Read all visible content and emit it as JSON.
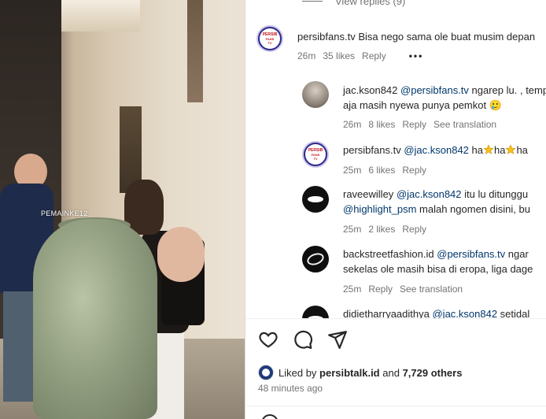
{
  "photo": {
    "watermark": "PEMAINKE12"
  },
  "view_replies": "View replies (9)",
  "main_comment": {
    "username": "persibfans.tv",
    "text": "Bisa nego sama ole buat musim depan",
    "time": "26m",
    "likes": "35 likes",
    "reply": "Reply",
    "more": "•••",
    "avatar_label_1": "PERSIB",
    "avatar_label_2": "FANS",
    "avatar_label_3": "TV"
  },
  "replies": [
    {
      "username": "jac.kson842",
      "mention": "@persibfans.tv",
      "text_line1": " ngarep lu. , tempat",
      "text_line2": "aja masih nyewa punya pemkot 🥲",
      "time": "26m",
      "likes": "8 likes",
      "reply": "Reply",
      "translate": "See translation"
    },
    {
      "username": "persibfans.tv",
      "mention": "@jac.kson842",
      "text_parts": [
        " ha",
        "ha",
        "ha"
      ],
      "time": "25m",
      "likes": "6 likes",
      "reply": "Reply"
    },
    {
      "username": "raveewilley",
      "mention": "@jac.kson842",
      "text_line1": " itu lu ditunggu",
      "mention2": "@highlight_psm",
      "text_line2": " malah ngomen disini, bu",
      "time": "25m",
      "likes": "2 likes",
      "reply": "Reply"
    },
    {
      "username": "backstreetfashion.id",
      "mention": "@persibfans.tv",
      "text_line1": " ngar",
      "text_line2": "sekelas ole masih bisa di eropa, liga dage",
      "time": "25m",
      "reply": "Reply",
      "translate": "See translation"
    },
    {
      "username": "didietharryaadithya",
      "mention": "@jac.kson842",
      "text_line1": " setidal"
    }
  ],
  "actions": {
    "like_icon": "heart-icon",
    "comment_icon": "comment-icon",
    "share_icon": "paper-plane-icon"
  },
  "liked_by": {
    "prefix": "Liked by ",
    "user": "persibtalk.id",
    "middle": " and ",
    "count": "7,729 others"
  },
  "time_ago": "48 minutes ago",
  "colors": {
    "mention": "#00376b",
    "meta": "#737373",
    "text": "#262626"
  }
}
